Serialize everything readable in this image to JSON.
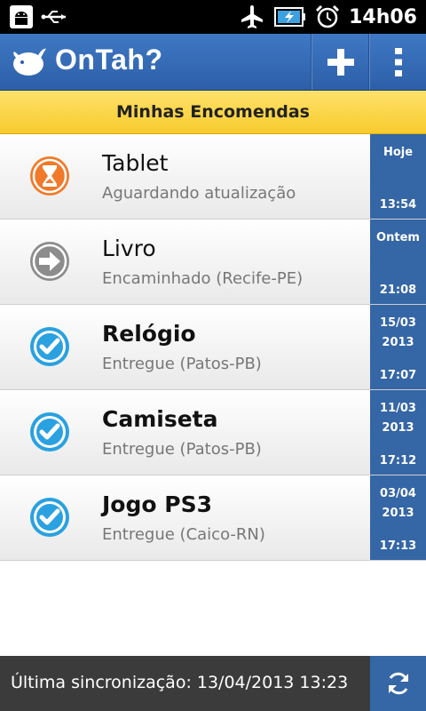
{
  "status_bar": {
    "time": "14h06",
    "left_icons": [
      "android-debug-icon",
      "usb-icon"
    ],
    "right_icons": [
      "airplane-mode-icon",
      "battery-charging-icon",
      "alarm-icon"
    ]
  },
  "app_bar": {
    "title": "OnTah?",
    "logo_icon": "bird-logo-icon",
    "add_icon": "plus-icon",
    "menu_icon": "overflow-menu-icon"
  },
  "section": {
    "title": "Minhas Encomendas"
  },
  "items": [
    {
      "title": "Tablet",
      "status": "Aguardando atualização",
      "icon": "hourglass-icon",
      "date": "Hoje",
      "time": "13:54",
      "bold": false
    },
    {
      "title": "Livro",
      "status": "Encaminhado (Recife-PE)",
      "icon": "arrow-right-icon",
      "date": "Ontem",
      "time": "21:08",
      "bold": false
    },
    {
      "title": "Relógio",
      "status": "Entregue (Patos-PB)",
      "icon": "check-icon",
      "date": "15/03\n2013",
      "time": "17:07",
      "bold": true
    },
    {
      "title": "Camiseta",
      "status": "Entregue (Patos-PB)",
      "icon": "check-icon",
      "date": "11/03\n2013",
      "time": "17:12",
      "bold": true
    },
    {
      "title": "Jogo PS3",
      "status": "Entregue (Caico-RN)",
      "icon": "check-icon",
      "date": "03/04\n2013",
      "time": "17:13",
      "bold": true
    }
  ],
  "footer": {
    "sync_text": "Última sincronização: 13/04/2013 13:23",
    "refresh_icon": "refresh-icon"
  },
  "colors": {
    "action_bar": "#3566a6",
    "section_header": "#f7cb2e",
    "date_column": "#3566a6",
    "footer": "#3b3b3b",
    "pending_orange": "#f07a2a",
    "forward_gray": "#8c8c8c",
    "delivered_blue": "#2aa1e0"
  }
}
